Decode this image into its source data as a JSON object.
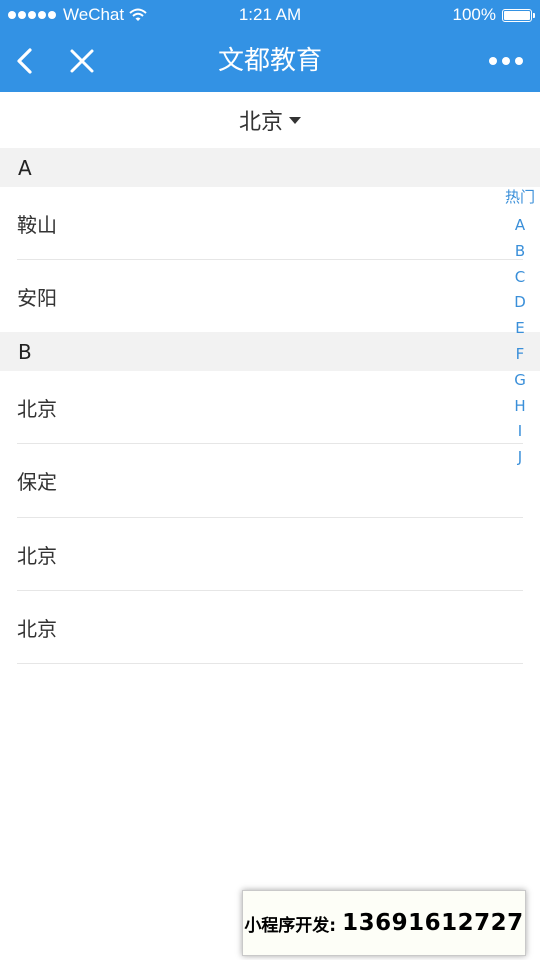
{
  "status_bar": {
    "carrier": "WeChat",
    "time": "1:21 AM",
    "battery": "100%",
    "signal_icon": "signal-dots-icon",
    "wifi_icon": "wifi-icon",
    "battery_icon": "battery-icon"
  },
  "nav": {
    "title": "文都教育",
    "back_icon": "chevron-left-icon",
    "close_icon": "close-icon",
    "more_icon": "more-dots-icon",
    "bar_color": "#3392e4"
  },
  "city_selector": {
    "value": "北京",
    "icon": "caret-down-icon"
  },
  "sections": [
    {
      "header": "A",
      "items": [
        "鞍山",
        "安阳"
      ]
    },
    {
      "header": "B",
      "items": [
        "北京",
        "保定",
        "北京",
        "北京"
      ]
    }
  ],
  "index_bar": {
    "hot_label": "热门",
    "letters": [
      "A",
      "B",
      "C",
      "D",
      "E",
      "F",
      "G",
      "H",
      "I",
      "J"
    ],
    "color": "#3a8fd9"
  },
  "watermark": {
    "label": "小程序开发:",
    "phone": "13691612727"
  }
}
